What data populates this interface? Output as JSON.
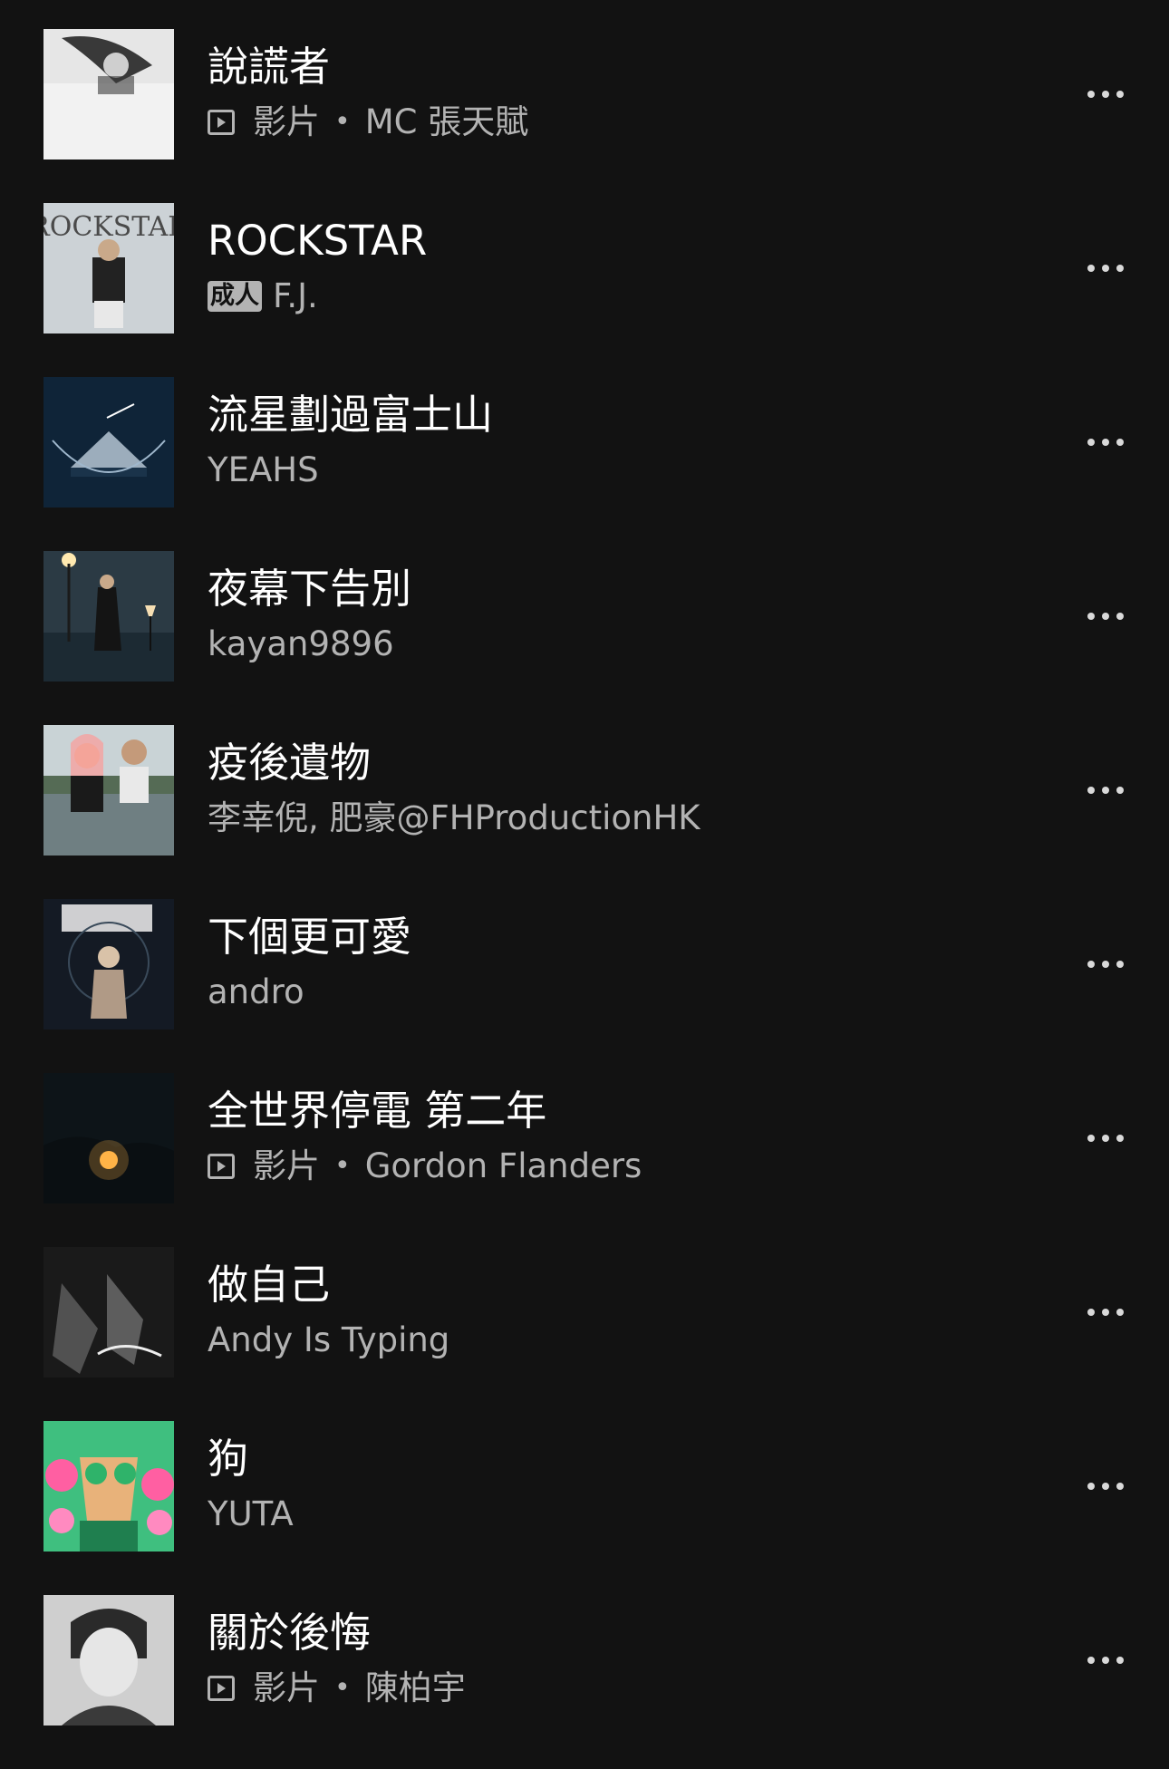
{
  "colors": {
    "background": "#121212",
    "title": "#ffffff",
    "subtitle": "#b3b3b3"
  },
  "tracks": [
    {
      "title": "說謊者",
      "type_label": "影片",
      "artist": "MC 張天賦",
      "video": true,
      "explicit": false
    },
    {
      "title": "ROCKSTAR",
      "explicit_label": "成人",
      "artist": "F.J.",
      "video": false,
      "explicit": true
    },
    {
      "title": "流星劃過富士山",
      "artist": "YEAHS",
      "video": false,
      "explicit": false
    },
    {
      "title": "夜幕下告別",
      "artist": "kayan9896",
      "video": false,
      "explicit": false
    },
    {
      "title": "疫後遺物",
      "artist": "李幸倪, 肥豪@FHProductionHK",
      "video": false,
      "explicit": false
    },
    {
      "title": "下個更可愛",
      "artist": "andro",
      "video": false,
      "explicit": false
    },
    {
      "title": "全世界停電 第二年",
      "type_label": "影片",
      "artist": "Gordon Flanders",
      "video": true,
      "explicit": false
    },
    {
      "title": "做自己",
      "artist": "Andy Is Typing",
      "video": false,
      "explicit": false
    },
    {
      "title": "狗",
      "artist": "YUTA",
      "video": false,
      "explicit": false
    },
    {
      "title": "關於後悔",
      "type_label": "影片",
      "artist": "陳柏宇",
      "video": true,
      "explicit": false
    }
  ]
}
